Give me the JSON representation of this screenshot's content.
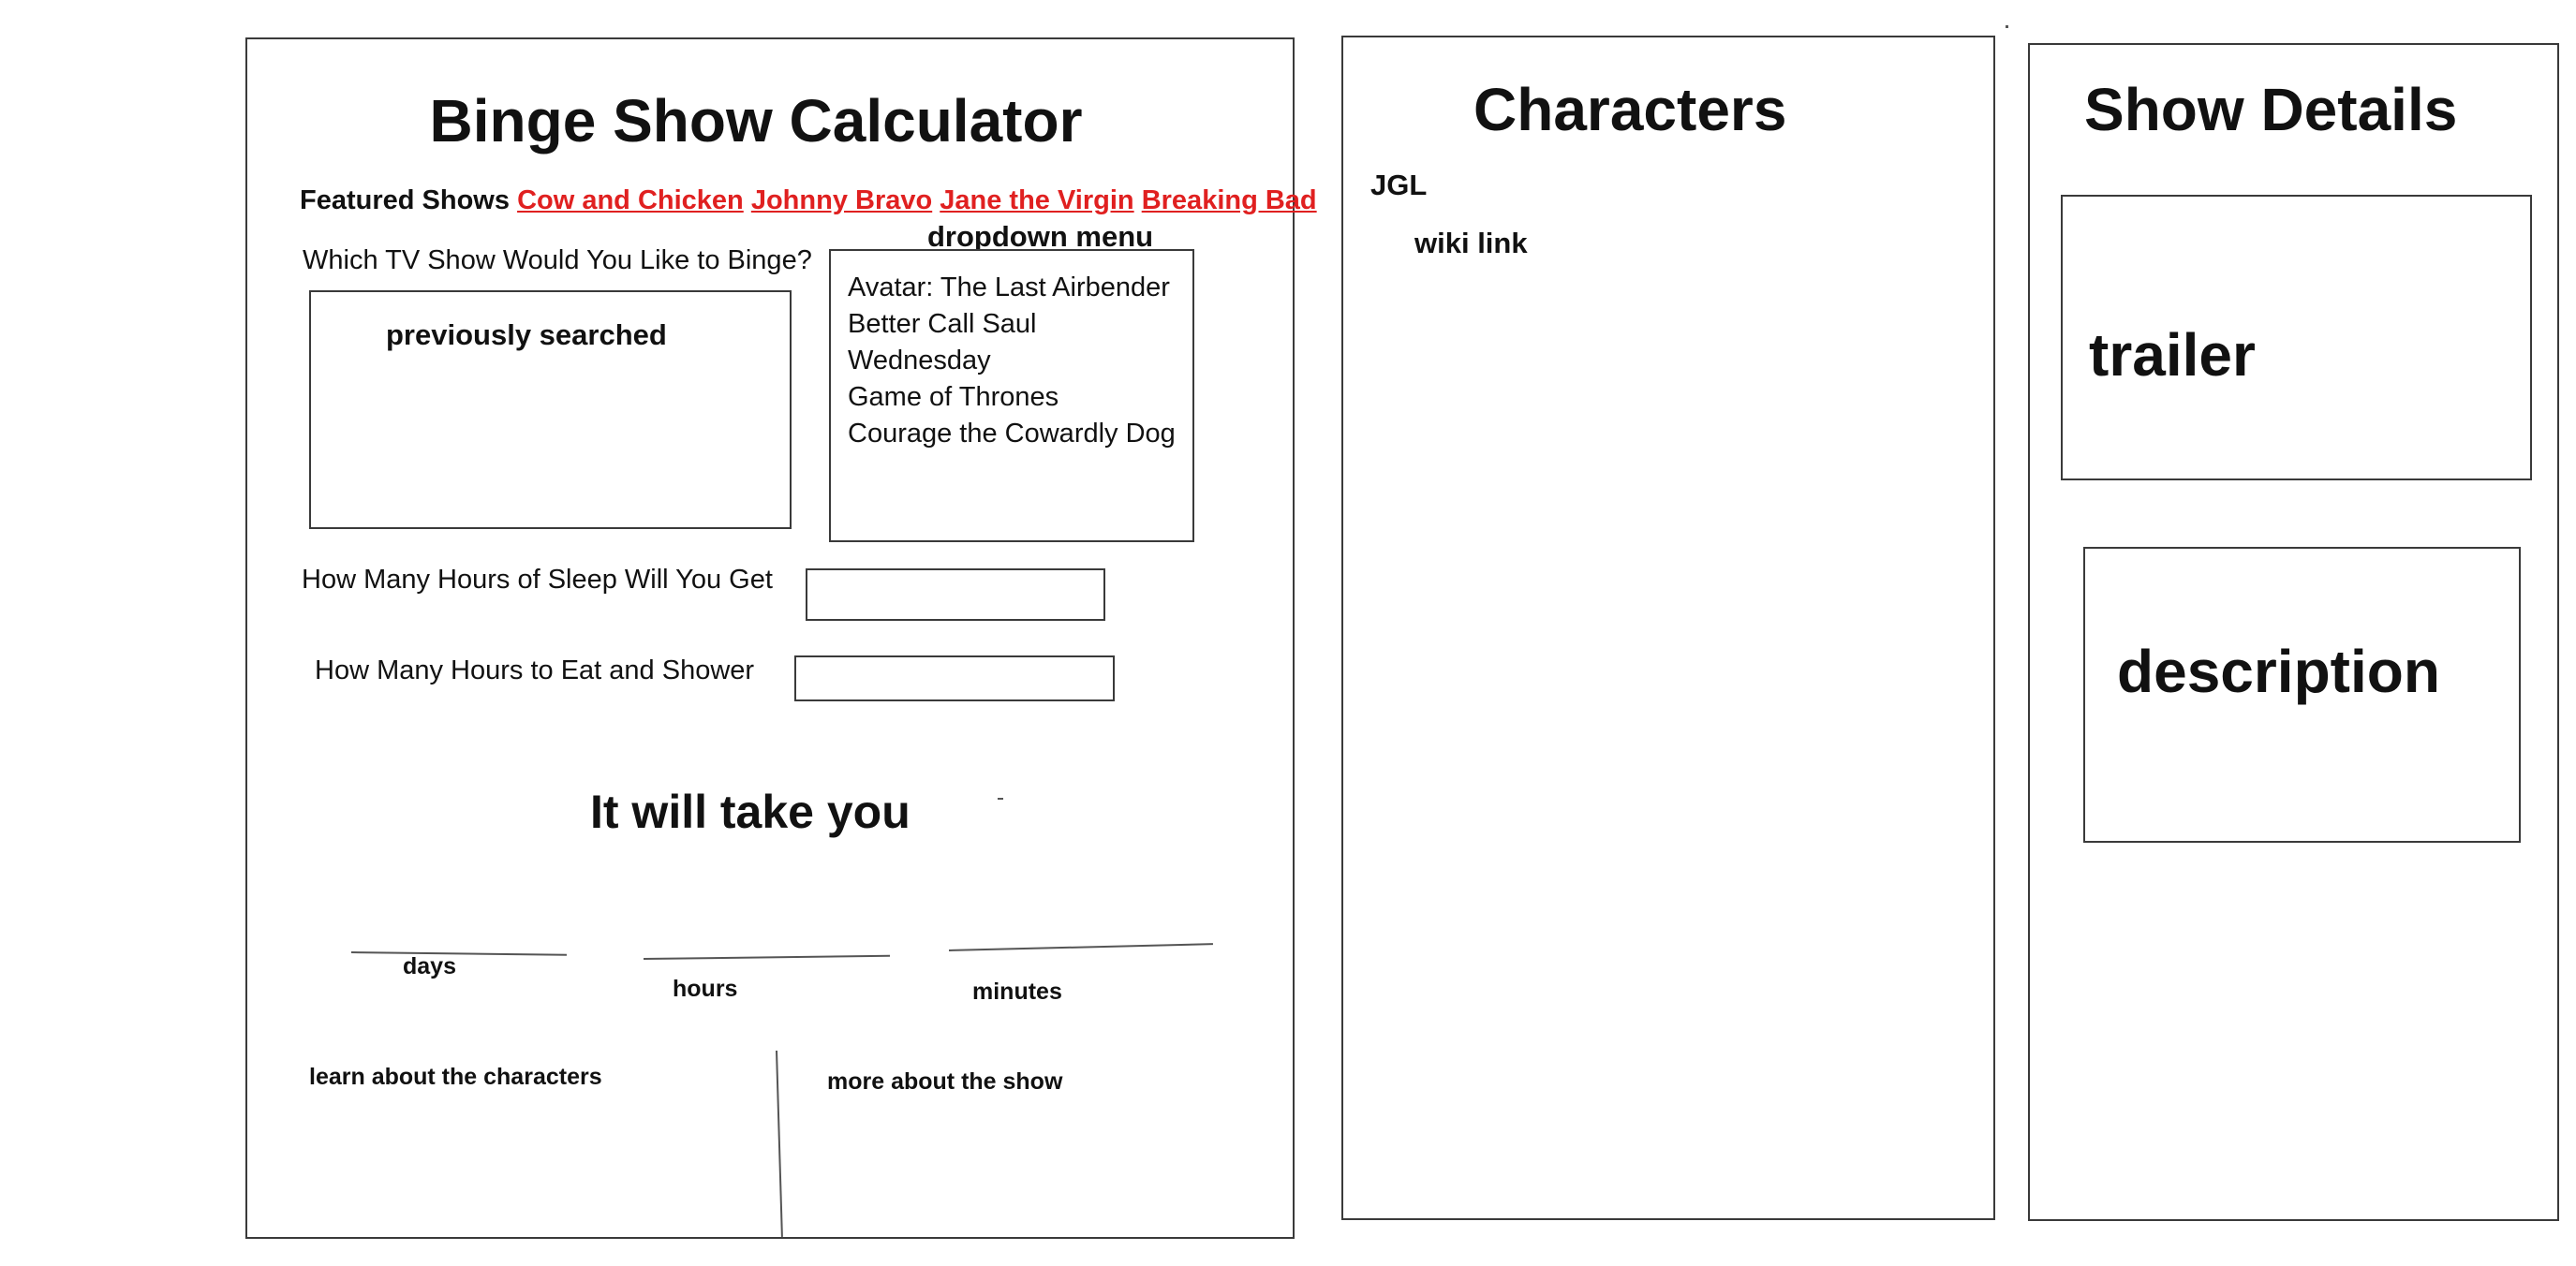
{
  "calculator": {
    "title": "Binge Show Calculator",
    "featured_label": "Featured Shows",
    "featured_shows": [
      "Cow and Chicken",
      "Johnny Bravo",
      "Jane the Virgin",
      "Breaking Bad"
    ],
    "question_show": "Which TV Show Would You Like to Binge?",
    "previously_searched_label": "previously searched",
    "dropdown_label": "dropdown menu",
    "dropdown_options": [
      "Avatar: The Last Airbender",
      "Better Call Saul",
      "Wednesday",
      "Game of Thrones",
      "Courage the Cowardly Dog"
    ],
    "sleep_label": "How Many Hours of Sleep Will You Get",
    "eat_label": "How Many Hours to Eat and Shower",
    "result_heading": "It will take you",
    "days_label": "days",
    "hours_label": "hours",
    "minutes_label": "minutes",
    "characters_link": "learn about the characters",
    "show_link": "more about the show"
  },
  "characters": {
    "title": "Characters",
    "character_name": "JGL",
    "wiki_link": "wiki link"
  },
  "show_details": {
    "title": "Show Details",
    "trailer_label": "trailer",
    "description_label": "description"
  },
  "colors": {
    "link": "#e02020",
    "border": "#3a3a3a"
  }
}
